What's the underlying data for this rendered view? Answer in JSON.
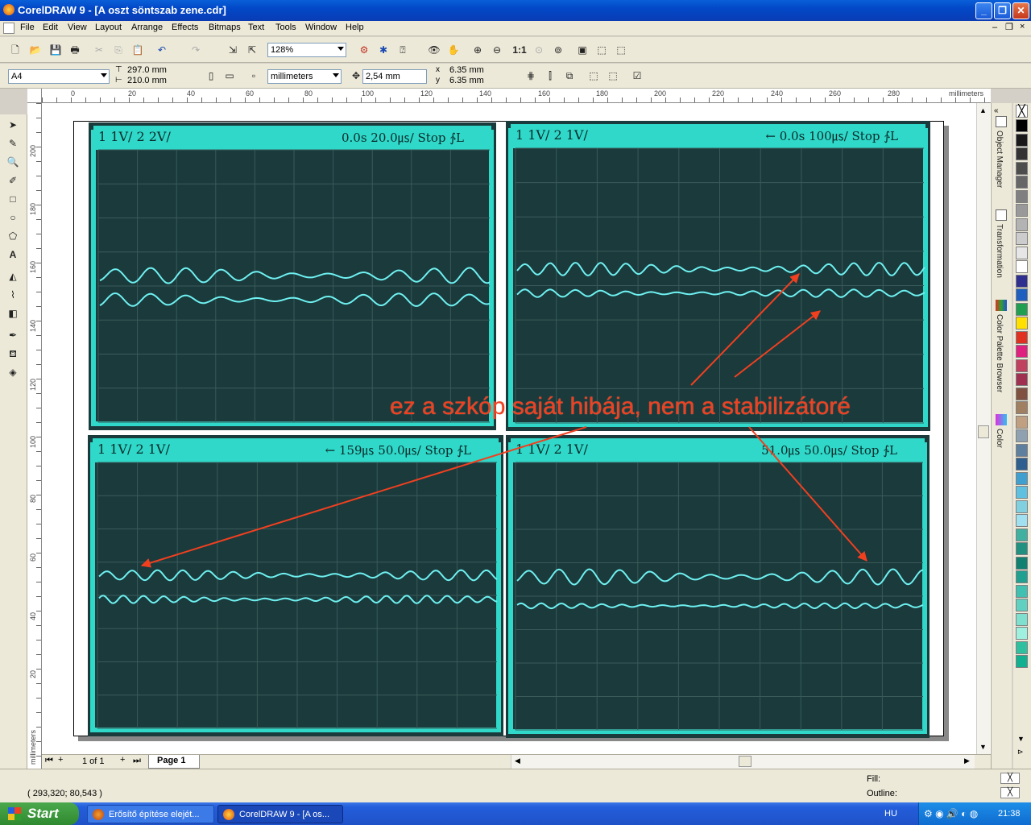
{
  "window": {
    "title": "CorelDRAW 9 - [A oszt söntszab zene.cdr]"
  },
  "menu": [
    "File",
    "Edit",
    "View",
    "Layout",
    "Arrange",
    "Effects",
    "Bitmaps",
    "Text",
    "Tools",
    "Window",
    "Help"
  ],
  "toolbar": {
    "zoom": "128%"
  },
  "propbar": {
    "paper": "A4",
    "width": "297.0 mm",
    "height": "210.0 mm",
    "units": "millimeters",
    "nudge": "2,54 mm",
    "dup_x": "6.35 mm",
    "dup_y": "6.35 mm"
  },
  "ruler": {
    "units_label": "millimeters",
    "h_ticks": [
      "0",
      "20",
      "40",
      "60",
      "80",
      "100",
      "120",
      "140",
      "160",
      "180",
      "200",
      "220",
      "240",
      "260",
      "280"
    ],
    "v_ticks": [
      "200",
      "180",
      "160",
      "140",
      "120",
      "100",
      "80",
      "60",
      "40",
      "20"
    ],
    "v_units": "millimeters"
  },
  "scopes": [
    {
      "hdr1": "1  1V/  2  2V/",
      "hdr2": "0.0s  20.0㎲/  Stop  ∱L"
    },
    {
      "hdr1": "1  1V/  2  1V/",
      "hdr2": "← 0.0s  100㎲/  Stop  ∱L"
    },
    {
      "hdr1": "1  1V/  2  1V/",
      "hdr2": "← 159㎲  50.0㎲/  Stop  ∱L"
    },
    {
      "hdr1": "1  1V/  2  1V/",
      "hdr2": "51.0㎲  50.0㎲/  Stop  ∱L"
    }
  ],
  "annotation": "ez a szkóp  saját hibája, nem a stabilizátoré",
  "pagenav": {
    "count": "1 of 1",
    "page_tab": "Page 1"
  },
  "dockers": [
    "Object Manager",
    "Transformation",
    "Color Palette Browser",
    "Color"
  ],
  "palette": [
    "#000000",
    "#1a1a1a",
    "#333333",
    "#4d4d4d",
    "#666666",
    "#808080",
    "#999999",
    "#b3b3b3",
    "#cccccc",
    "#e6e6e6",
    "#ffffff",
    "#2f2f8f",
    "#1f5fbf",
    "#1f9f4f",
    "#ffe000",
    "#e03020",
    "#e0207f",
    "#c04060",
    "#a03050",
    "#805040",
    "#a08060",
    "#c0a080",
    "#8fa0b0",
    "#5f7f9f",
    "#2f5f8f",
    "#3fa0d0",
    "#60c0e0",
    "#80d0e0",
    "#a0e0f0",
    "#40b0a0",
    "#209080",
    "#108070",
    "#20a090",
    "#40c0b0",
    "#60d0c0",
    "#80e0d0",
    "#a0f0e0",
    "#30c0a0",
    "#10b090"
  ],
  "status": {
    "coords": "( 293,320; 80,543 )",
    "fill": "Fill:",
    "outline": "Outline:"
  },
  "taskbar": {
    "start": "Start",
    "tasks": [
      "Erősítő építése elejét...",
      "CorelDRAW 9 - [A os..."
    ],
    "lang": "HU",
    "clock": "21:38"
  }
}
